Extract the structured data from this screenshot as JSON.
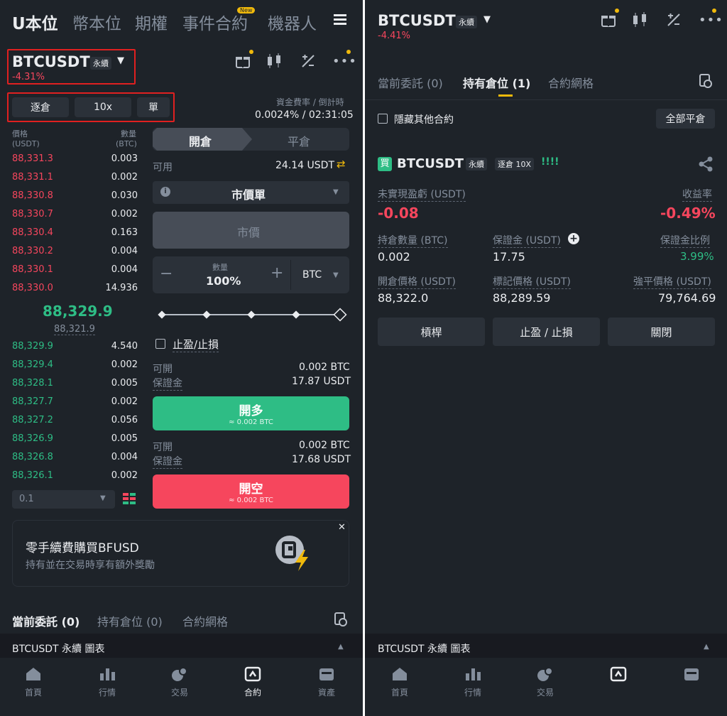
{
  "left": {
    "topnav": [
      "U本位",
      "幣本位",
      "期權",
      "事件合約",
      "機器人"
    ],
    "new_badge": "New",
    "symbol": "BTCUSDT",
    "perp": "永續",
    "change": "-4.31%",
    "margin_mode": "逐倉",
    "leverage": "10x",
    "position_mode": "單",
    "funding_label": "資金費率 / 倒計時",
    "funding_value": "0.0024% / 02:31:05",
    "ob_price_hdr": "價格",
    "ob_price_unit": "(USDT)",
    "ob_qty_hdr": "數量",
    "ob_qty_unit": "(BTC)",
    "asks": [
      [
        "88,331.3",
        "0.003"
      ],
      [
        "88,331.1",
        "0.002"
      ],
      [
        "88,330.8",
        "0.030"
      ],
      [
        "88,330.7",
        "0.002"
      ],
      [
        "88,330.4",
        "0.163"
      ],
      [
        "88,330.2",
        "0.004"
      ],
      [
        "88,330.1",
        "0.004"
      ],
      [
        "88,330.0",
        "14.936"
      ]
    ],
    "mid_price": "88,329.9",
    "mark_price": "88,321.9",
    "bids": [
      [
        "88,329.9",
        "4.540"
      ],
      [
        "88,329.4",
        "0.002"
      ],
      [
        "88,328.1",
        "0.005"
      ],
      [
        "88,327.7",
        "0.002"
      ],
      [
        "88,327.2",
        "0.056"
      ],
      [
        "88,326.9",
        "0.005"
      ],
      [
        "88,326.8",
        "0.004"
      ],
      [
        "88,326.1",
        "0.002"
      ]
    ],
    "depth_step": "0.1",
    "tab_open": "開倉",
    "tab_close": "平倉",
    "avail_label": "可用",
    "avail_value": "24.14 USDT",
    "order_type": "市價單",
    "price_placeholder": "市價",
    "qty_label": "數量",
    "qty_value": "100%",
    "qty_unit": "BTC",
    "tpsl": "止盈/止損",
    "long_can_label": "可開",
    "long_can_value": "0.002 BTC",
    "long_margin_label": "保證金",
    "long_margin_value": "17.87 USDT",
    "long_btn": "開多",
    "long_sub": "≈ 0.002 BTC",
    "short_can_label": "可開",
    "short_can_value": "0.002 BTC",
    "short_margin_label": "保證金",
    "short_margin_value": "17.68 USDT",
    "short_btn": "開空",
    "short_sub": "≈ 0.002 BTC",
    "promo_title": "零手續費購買BFUSD",
    "promo_desc": "持有並在交易時享有額外獎勵",
    "tabs": [
      "當前委託 (0)",
      "持有倉位 (0)",
      "合約網格"
    ],
    "footer": "BTCUSDT 永續  圖表"
  },
  "right": {
    "symbol": "BTCUSDT",
    "perp": "永續",
    "change": "-4.41%",
    "tabs": [
      "當前委託 (0)",
      "持有倉位 (1)",
      "合約網格"
    ],
    "hide_others": "隱藏其他合約",
    "close_all": "全部平倉",
    "pos_side": "買",
    "pos_symbol": "BTCUSDT",
    "pos_perp": "永續",
    "pos_mode": "逐倉 10X",
    "pos_bars": "!!!!",
    "pnl_label": "未實現盈虧 (USDT)",
    "pnl_value": "-0.08",
    "roe_label": "收益率",
    "roe_value": "-0.49%",
    "size_label": "持倉數量 (BTC)",
    "size_value": "0.002",
    "margin_label": "保證金 (USDT)",
    "margin_value": "17.75",
    "ratio_label": "保證金比例",
    "ratio_value": "3.99%",
    "entry_label": "開倉價格 (USDT)",
    "entry_value": "88,322.0",
    "mark_label": "標記價格 (USDT)",
    "mark_value": "88,289.59",
    "liq_label": "強平價格 (USDT)",
    "liq_value": "79,764.69",
    "btn_leverage": "槓桿",
    "btn_tpsl": "止盈 / 止損",
    "btn_close": "關閉",
    "footer": "BTCUSDT 永續  圖表"
  },
  "bottom_nav": [
    "首頁",
    "行情",
    "交易",
    "合約",
    "資產"
  ],
  "colors": {
    "bg": "#1e2329",
    "up": "#2ebd85",
    "down": "#f6465d",
    "accent": "#f0b90b"
  }
}
